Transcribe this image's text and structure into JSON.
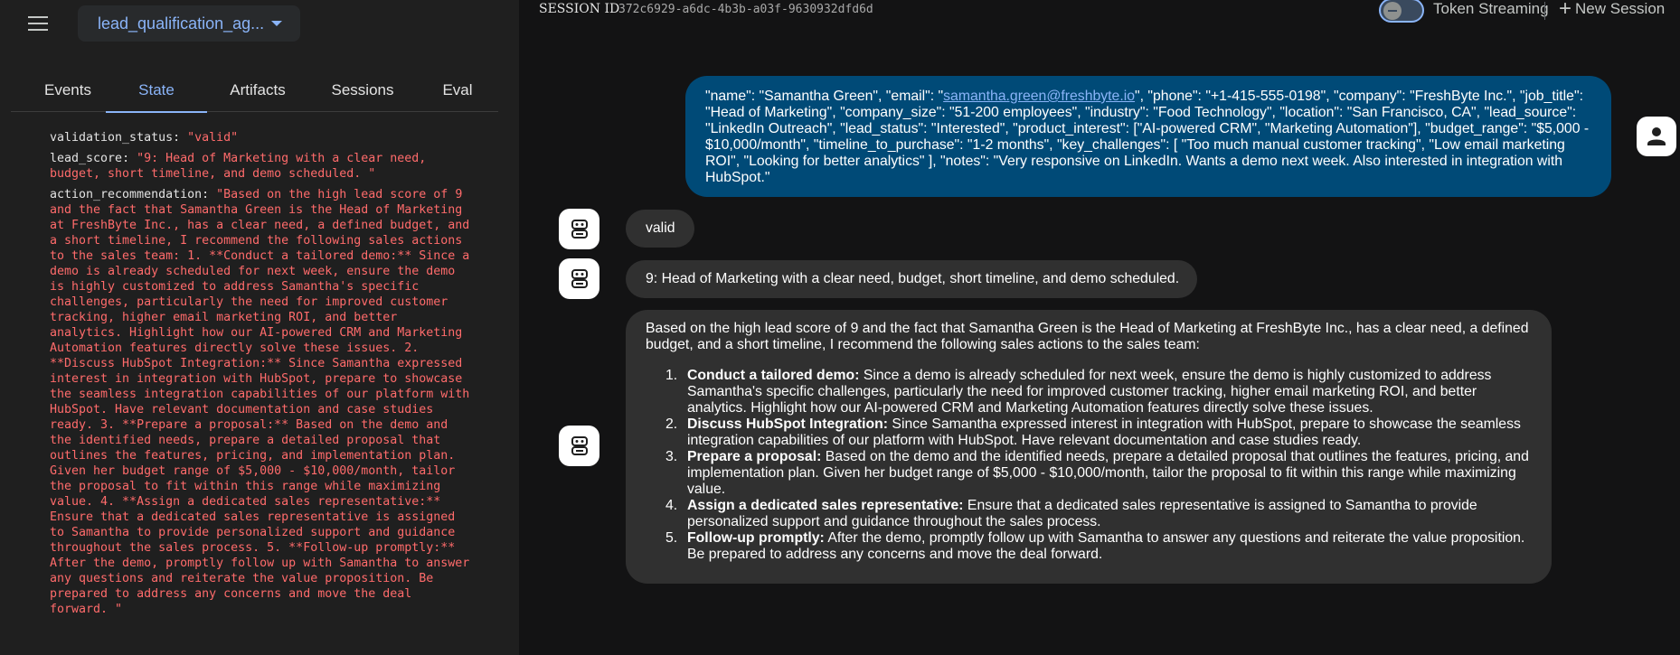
{
  "agent": {
    "name": "lead_qualification_ag..."
  },
  "tabs": [
    "Events",
    "State",
    "Artifacts",
    "Sessions",
    "Eval"
  ],
  "state": [
    {
      "key": "validation_status",
      "value": "\"valid\""
    },
    {
      "key": "lead_score",
      "value": "\"9: Head of Marketing with a clear need, budget, short timeline, and demo scheduled. \""
    },
    {
      "key": "action_recommendation",
      "value": "\"Based on the high lead score of 9 and the fact that Samantha Green is the Head of Marketing at FreshByte Inc., has a clear need, a defined budget, and a short timeline, I recommend the following sales actions to the sales team: 1. **Conduct a tailored demo:** Since a demo is already scheduled for next week, ensure the demo is highly customized to address Samantha's specific challenges, particularly the need for improved customer tracking, higher email marketing ROI, and better analytics. Highlight how our AI-powered CRM and Marketing Automation features directly solve these issues. 2. **Discuss HubSpot Integration:** Since Samantha expressed interest in integration with HubSpot, prepare to showcase the seamless integration capabilities of our platform with HubSpot. Have relevant documentation and case studies ready. 3. **Prepare a proposal:** Based on the demo and the identified needs, prepare a detailed proposal that outlines the features, pricing, and implementation plan. Given her budget range of $5,000 - $10,000/month, tailor the proposal to fit within this range while maximizing value. 4. **Assign a dedicated sales representative:** Ensure that a dedicated sales representative is assigned to Samantha to provide personalized support and guidance throughout the sales process. 5. **Follow-up promptly:** After the demo, promptly follow up with Samantha to answer any questions and reiterate the value proposition. Be prepared to address any concerns and move the deal forward. \""
    }
  ],
  "session": {
    "label": "SESSION ID",
    "id": "372c6929-a6dc-4b3b-a03f-9630932dfd6d"
  },
  "toolbar": {
    "streaming_label": "Token Streaming",
    "new_session_label": "New Session"
  },
  "user_message": {
    "before": "\"name\": \"Samantha Green\", \"email\": \"",
    "email": "samantha.green@freshbyte.io",
    "after": "\", \"phone\": \"+1-415-555-0198\", \"company\": \"FreshByte Inc.\", \"job_title\": \"Head of Marketing\", \"company_size\": \"51-200 employees\", \"industry\": \"Food Technology\", \"location\": \"San Francisco, CA\", \"lead_source\": \"LinkedIn Outreach\", \"lead_status\": \"Interested\", \"product_interest\": [\"AI-powered CRM\", \"Marketing Automation\"], \"budget_range\": \"$5,000 - $10,000/month\", \"timeline_to_purchase\": \"1-2 months\", \"key_challenges\": [ \"Too much manual customer tracking\", \"Low email marketing ROI\", \"Looking for better analytics\" ], \"notes\": \"Very responsive on LinkedIn. Wants a demo next week. Also interested in integration with HubSpot.\""
  },
  "bot_messages": {
    "m1": "valid",
    "m2": "9: Head of Marketing with a clear need, budget, short timeline, and demo scheduled.",
    "m3_intro": "Based on the high lead score of 9 and the fact that Samantha Green is the Head of Marketing at FreshByte Inc., has a clear need, a defined budget, and a short timeline, I recommend the following sales actions to the sales team:",
    "m3_items": [
      {
        "num": "1.",
        "title": "Conduct a tailored demo:",
        "text": " Since a demo is already scheduled for next week, ensure the demo is highly customized to address Samantha's specific challenges, particularly the need for improved customer tracking, higher email marketing ROI, and better analytics. Highlight how our AI-powered CRM and Marketing Automation features directly solve these issues."
      },
      {
        "num": "2.",
        "title": "Discuss HubSpot Integration:",
        "text": " Since Samantha expressed interest in integration with HubSpot, prepare to showcase the seamless integration capabilities of our platform with HubSpot. Have relevant documentation and case studies ready."
      },
      {
        "num": "3.",
        "title": "Prepare a proposal:",
        "text": " Based on the demo and the identified needs, prepare a detailed proposal that outlines the features, pricing, and implementation plan. Given her budget range of $5,000 - $10,000/month, tailor the proposal to fit within this range while maximizing value."
      },
      {
        "num": "4.",
        "title": "Assign a dedicated sales representative:",
        "text": " Ensure that a dedicated sales representative is assigned to Samantha to provide personalized support and guidance throughout the sales process."
      },
      {
        "num": "5.",
        "title": "Follow-up promptly:",
        "text": " After the demo, promptly follow up with Samantha to answer any questions and reiterate the value proposition. Be prepared to address any concerns and move the deal forward."
      }
    ]
  },
  "colors": {
    "accent": "#8ab4f8",
    "user_bubble": "#004a77",
    "bot_bubble": "#303030",
    "state_value": "#ff6b6b"
  }
}
